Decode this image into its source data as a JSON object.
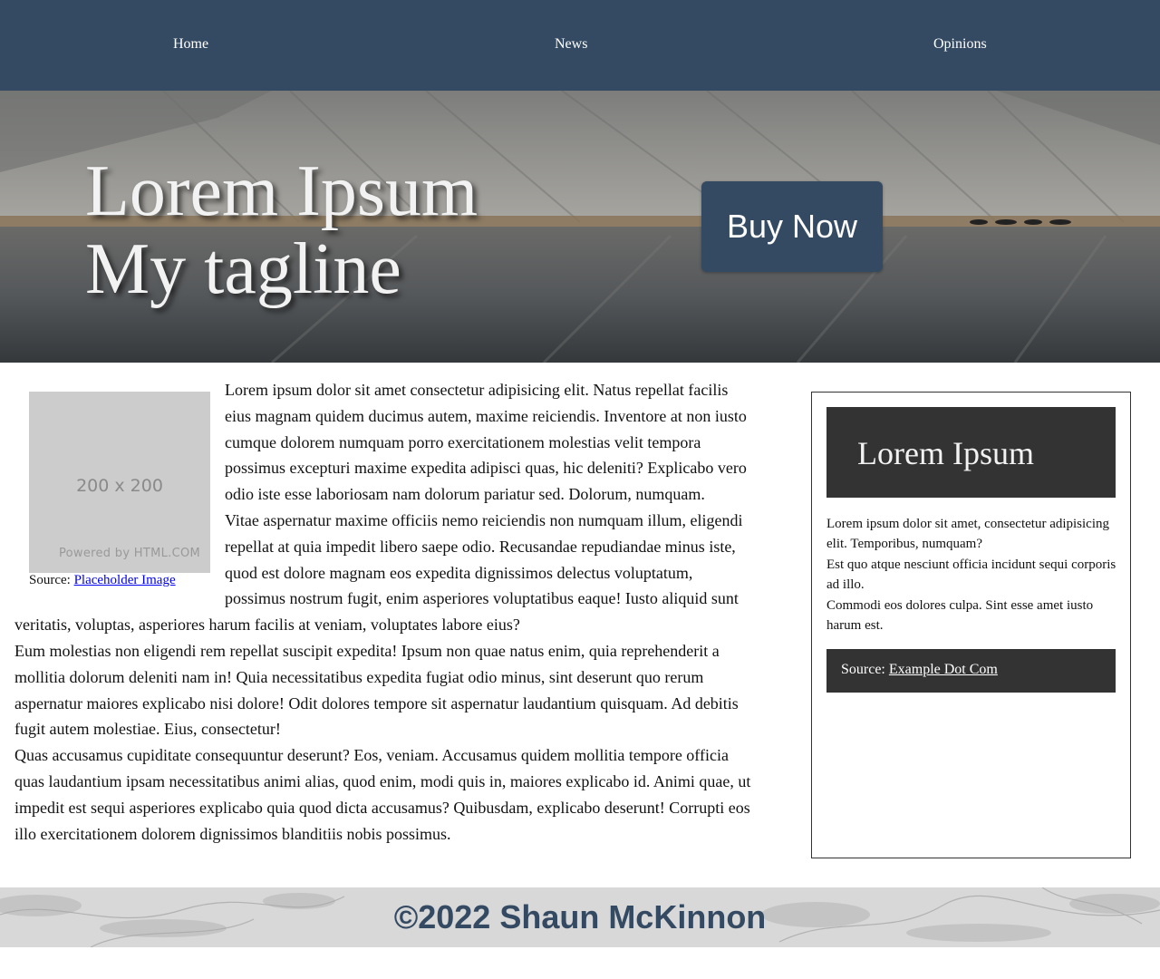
{
  "nav": {
    "home": "Home",
    "news": "News",
    "opinions": "Opinions"
  },
  "hero": {
    "title_line1": "Lorem Ipsum",
    "title_line2": "My tagline",
    "buy_label": "Buy Now"
  },
  "main": {
    "image": {
      "dimensions": "200 x 200",
      "powered_by": "Powered by HTML.COM"
    },
    "caption": {
      "prefix": "Source: ",
      "link": "Placeholder Image"
    },
    "paragraphs": [
      "Lorem ipsum dolor sit amet consectetur adipisicing elit. Natus repellat facilis eius magnam quidem ducimus autem, maxime reiciendis. Inventore at non iusto cumque dolorem numquam porro exercitationem molestias velit tempora possimus excepturi maxime expedita adipisci quas, hic deleniti? Explicabo vero odio iste esse laboriosam nam dolorum pariatur sed. Dolorum, numquam.",
      "Vitae aspernatur maxime officiis nemo reiciendis non numquam illum, eligendi repellat at quia impedit libero saepe odio. Recusandae repudiandae minus iste, quod est dolore magnam eos expedita dignissimos delectus voluptatum, possimus nostrum fugit, enim asperiores voluptatibus eaque! Iusto aliquid sunt veritatis, voluptas, asperiores harum facilis at veniam, voluptates labore eius?",
      "Eum molestias non eligendi rem repellat suscipit expedita! Ipsum non quae natus enim, quia reprehenderit a mollitia dolorum deleniti nam in! Quia necessitatibus expedita fugiat odio minus, sint deserunt quo rerum aspernatur maiores explicabo nisi dolore! Odit dolores tempore sit aspernatur laudantium quisquam. Ad debitis fugit autem molestiae. Eius, consectetur!",
      "Quas accusamus cupiditate consequuntur deserunt? Eos, veniam. Accusamus quidem mollitia tempore officia quas laudantium ipsam necessitatibus animi alias, quod enim, modi quis in, maiores explicabo id. Animi quae, ut impedit est sequi asperiores explicabo quia quod dicta accusamus? Quibusdam, explicabo deserunt! Corrupti eos illo exercitationem dolorem dignissimos blanditiis nobis possimus."
    ]
  },
  "aside": {
    "heading": "Lorem Ipsum",
    "paragraphs": [
      "Lorem ipsum dolor sit amet, consectetur adipisicing elit. Temporibus, numquam?",
      "Est quo atque nesciunt officia incidunt sequi corporis ad illo.",
      "Commodi eos dolores culpa. Sint esse amet iusto harum est."
    ],
    "source_prefix": "Source: ",
    "source_link": "Example Dot Com"
  },
  "footer": {
    "copyright": "©2022 Shaun McKinnon"
  },
  "colors": {
    "nav_bg": "#344a62",
    "button_bg": "#344a62",
    "aside_dark": "#333333",
    "footer_text": "#344a62"
  }
}
